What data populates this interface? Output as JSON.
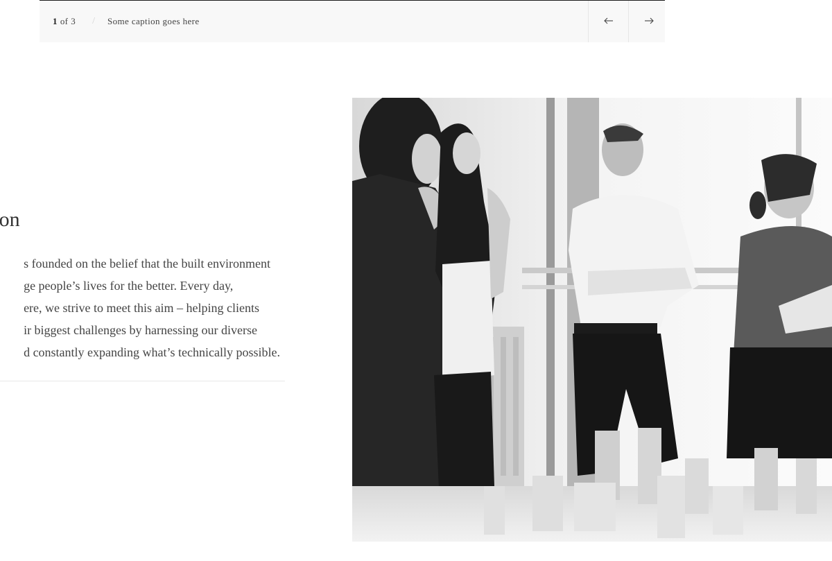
{
  "gallery": {
    "counter": {
      "current": "1",
      "separator": "of",
      "total": "3"
    },
    "caption": "Some caption goes here",
    "prev_icon": "arrow-left-icon",
    "next_icon": "arrow-right-icon"
  },
  "section": {
    "title": "tion",
    "body_lines": [
      "s founded on the belief that the built environment",
      "ge people’s lives for the better. Every day,",
      "ere, we strive to meet this aim – helping clients",
      "ir biggest challenges by harnessing our diverse",
      "d constantly expanding what’s technically possible."
    ]
  },
  "photo": {
    "description_icon": "team-photo-image"
  },
  "colors": {
    "caption_bar_bg": "#f8f8f8",
    "text": "#333333",
    "divider": "#e8e8e8"
  }
}
